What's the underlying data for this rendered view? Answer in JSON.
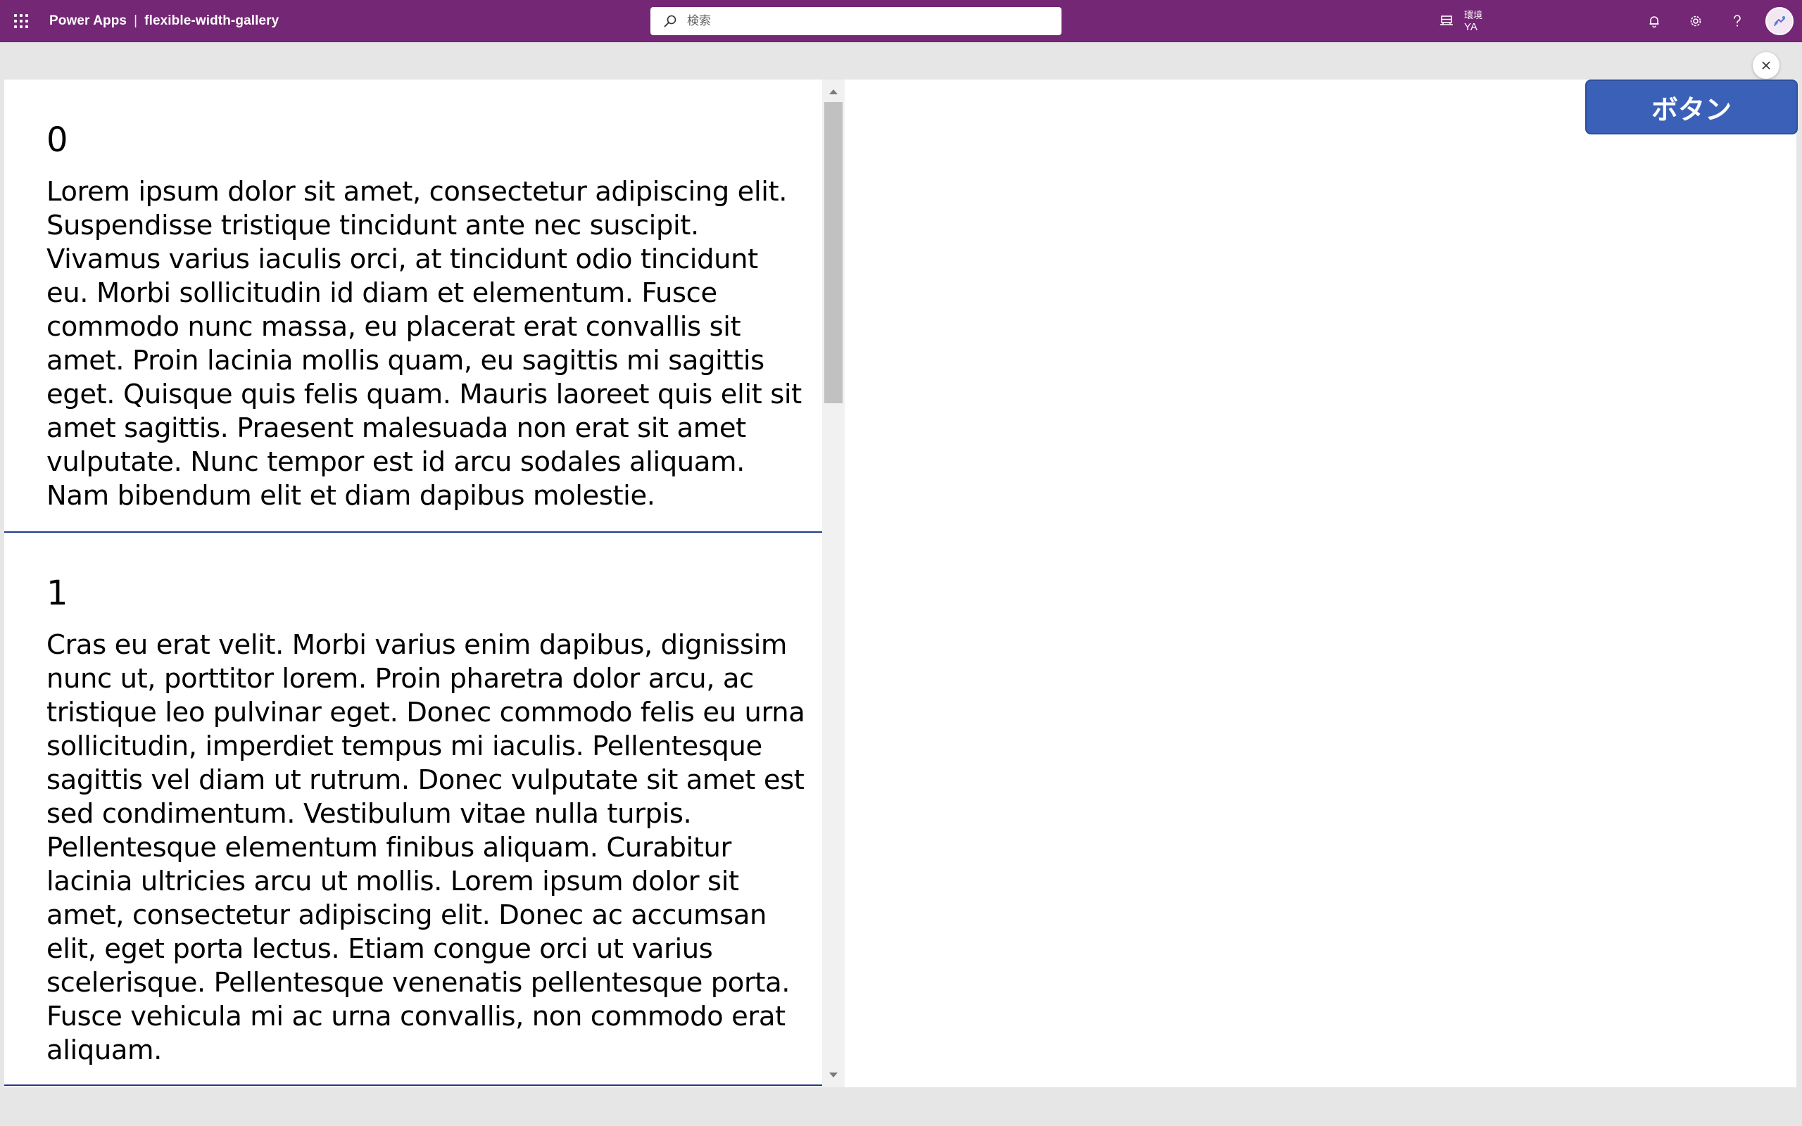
{
  "topbar": {
    "app_name": "Power Apps",
    "separator": "|",
    "app_title": "flexible-width-gallery",
    "search_placeholder": "検索",
    "environment_label": "環境",
    "environment_name": "YA",
    "background_color": "#742774"
  },
  "icons": {
    "app_launcher": "waffle-icon",
    "search": "search-icon",
    "environment": "environment-icon",
    "notifications": "bell-icon",
    "settings": "gear-icon",
    "help": "help-icon",
    "close": "close-icon"
  },
  "gallery": {
    "items": [
      {
        "index": "0",
        "text": "Lorem ipsum dolor sit amet, consectetur adipiscing elit. Suspendisse tristique tincidunt ante nec suscipit. Vivamus varius iaculis orci, at tincidunt odio tincidunt eu. Morbi sollicitudin id diam et elementum. Fusce commodo nunc massa, eu placerat erat convallis sit amet. Proin lacinia mollis quam, eu sagittis mi sagittis eget. Quisque quis felis quam. Mauris laoreet quis elit sit amet sagittis. Praesent malesuada non erat sit amet vulputate. Nunc tempor est id arcu sodales aliquam. Nam bibendum elit et diam dapibus molestie."
      },
      {
        "index": "1",
        "text": "Cras eu erat velit. Morbi varius enim dapibus, dignissim nunc ut, porttitor lorem. Proin pharetra dolor arcu, ac tristique leo pulvinar eget. Donec commodo felis eu urna sollicitudin, imperdiet tempus mi iaculis. Pellentesque sagittis vel diam ut rutrum. Donec vulputate sit amet est sed condimentum. Vestibulum vitae nulla turpis. Pellentesque elementum finibus aliquam. Curabitur lacinia ultricies arcu ut mollis. Lorem ipsum dolor sit amet, consectetur adipiscing elit. Donec ac accumsan elit, eget porta lectus. Etiam congue orci ut varius scelerisque. Pellentesque venenatis pellentesque porta. Fusce vehicula mi ac urna convallis, non commodo erat aliquam."
      }
    ],
    "divider_color": "#1f3a8a"
  },
  "action_button": {
    "label": "ボタン",
    "color": "#3a60b8"
  }
}
